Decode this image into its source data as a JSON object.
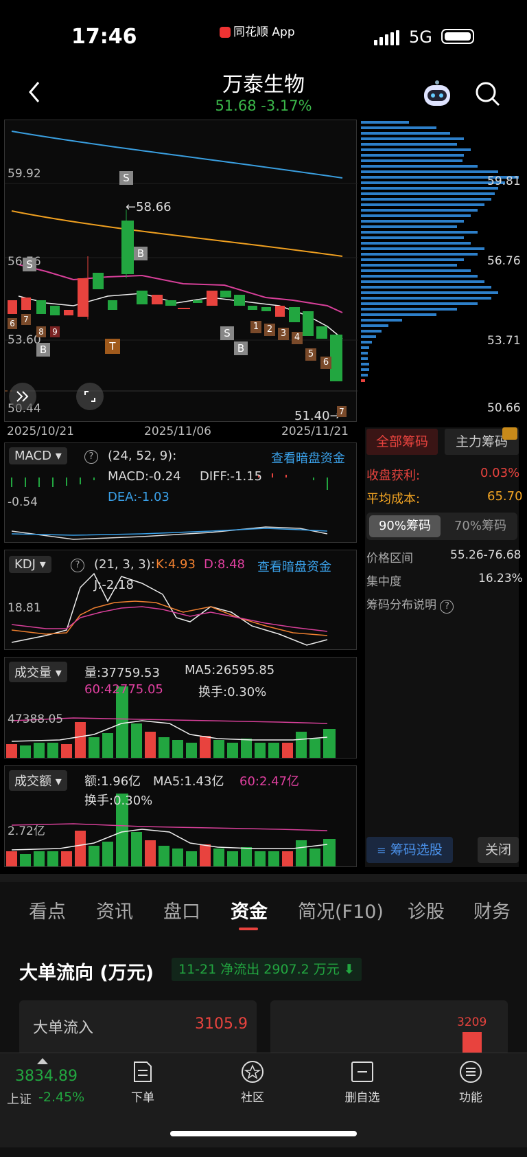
{
  "status": {
    "time": "17:46",
    "app": "同花顺 App",
    "network": "5G"
  },
  "header": {
    "title": "万泰生物",
    "price": "51.68",
    "change": "-3.17%"
  },
  "kline": {
    "y_labels": [
      "59.92",
      "56.76",
      "53.60",
      "50.44"
    ],
    "x_labels": [
      "2025/10/21",
      "2025/11/06",
      "2025/11/21"
    ],
    "high_label": "58.66",
    "low_label": "51.40",
    "markers": [
      "S",
      "B",
      "S",
      "B",
      "S",
      "B",
      "T",
      "6",
      "7",
      "8",
      "9",
      "1",
      "2",
      "3",
      "4",
      "5",
      "6",
      "7"
    ]
  },
  "chips": {
    "price_labels": [
      "59.81",
      "56.76",
      "53.71",
      "50.66"
    ],
    "tab_all": "全部筹码",
    "tab_main": "主力筹码",
    "profit_label": "收盘获利:",
    "profit_value": "0.03%",
    "avg_label": "平均成本:",
    "avg_value": "65.70",
    "opt90": "90%筹码",
    "opt70": "70%筹码",
    "range_label": "价格区间",
    "range_value": "55.26-76.68",
    "conc_label": "集中度",
    "conc_value": "16.23%",
    "explain": "筹码分布说明",
    "select_btn": "筹码选股",
    "close_btn": "关闭"
  },
  "macd": {
    "name": "MACD",
    "params": "(24, 52, 9):",
    "link": "查看暗盘资金",
    "macd": "MACD:-0.24",
    "diff": "DIFF:-1.15",
    "dea": "DEA:-1.03",
    "axis": "-0.54"
  },
  "kdj": {
    "name": "KDJ",
    "params": "(21, 3, 3):",
    "k": "K:4.93",
    "d": "D:8.48",
    "j": "J:-2.18",
    "link": "查看暗盘资金",
    "axis": "18.81"
  },
  "volume": {
    "name": "成交量",
    "qty": "量:37759.53",
    "ma5": "MA5:26595.85",
    "ma60": "60:42775.05",
    "turnover": "换手:0.30%",
    "axis": "47388.05"
  },
  "amount": {
    "name": "成交额",
    "amt": "额:1.96亿",
    "ma5": "MA5:1.43亿",
    "ma60": "60:2.47亿",
    "turnover": "换手:0.30%",
    "axis": "2.72亿"
  },
  "tabs": [
    "看点",
    "资讯",
    "盘口",
    "资金",
    "简况(F10)",
    "诊股",
    "财务"
  ],
  "flow": {
    "title": "大单流向 (万元)",
    "badge": "11-21 净流出 2907.2 万元",
    "inflow_label": "大单流入",
    "inflow_value": "3105.9",
    "bar_value": "3209"
  },
  "bottom": {
    "index_value": "3834.89",
    "index_name": "上证",
    "index_change": "-2.45%",
    "nav": [
      "下单",
      "社区",
      "删自选",
      "功能"
    ]
  }
}
